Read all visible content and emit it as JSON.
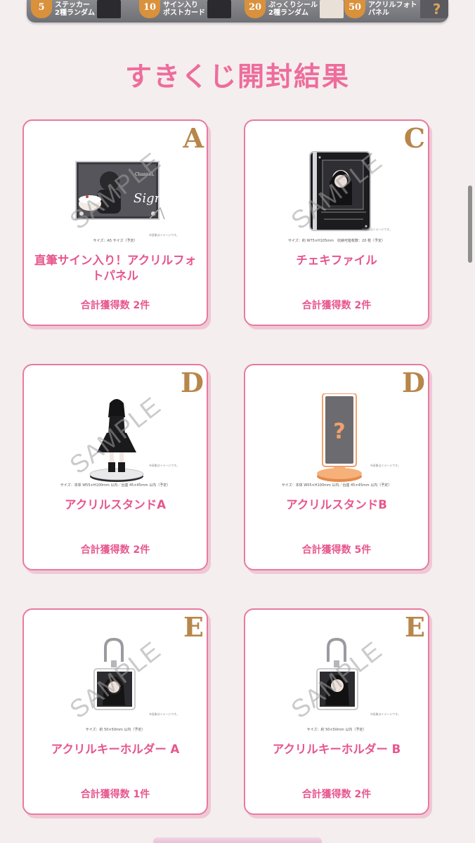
{
  "banner": {
    "bonuses": [
      {
        "badge": "5",
        "label_top": "ステッカー",
        "label_bottom": "2種ランダム"
      },
      {
        "badge": "10",
        "label_top": "サイン入り",
        "label_bottom": "ポストカード"
      },
      {
        "badge": "20",
        "label_top": "ぷっくりシール",
        "label_bottom": "2種ランダム"
      },
      {
        "badge": "50",
        "label_top": "アクリルフォト",
        "label_bottom": "パネル"
      }
    ],
    "mystery_mark": "?"
  },
  "title": "すきくじ開封結果",
  "cards": [
    {
      "rank": "A",
      "name": "直筆サイン入り！アクリルフォトパネル",
      "size": "サイズ：A5 サイズ（予定）",
      "count": "合計獲得数 2件",
      "watermark": "SAMPLE",
      "note": "※画像はイメージです。"
    },
    {
      "rank": "C",
      "name": "チェキファイル",
      "size": "サイズ：約 W75×H105mm　収納可能枚数：20 枚（予定）",
      "count": "合計獲得数 2件",
      "watermark": "SAMPLE",
      "note": "※画像はイメージです。"
    },
    {
      "rank": "D",
      "name": "アクリルスタンドA",
      "size": "サイズ：本体 W55×H100mm 以内／台座 45×45mm 以内（予定）",
      "count": "合計獲得数 2件",
      "watermark": "SAMPLE",
      "note": "※画像はイメージです。"
    },
    {
      "rank": "D",
      "name": "アクリルスタンドB",
      "size": "サイズ：本体 W55×H100mm 以内／台座 45×45mm 以内（予定）",
      "count": "合計獲得数 5件",
      "watermark": "",
      "note": "※画像はイメージです。"
    },
    {
      "rank": "E",
      "name": "アクリルキーホルダー A",
      "size": "サイズ：約 50×50mm 以内（予定）",
      "count": "合計獲得数 1件",
      "watermark": "SAMPLE",
      "note": "※画像はイメージです。"
    },
    {
      "rank": "E",
      "name": "アクリルキーホルダー B",
      "size": "サイズ：約 50×50mm 以内（予定）",
      "count": "合計獲得数 2件",
      "watermark": "SAMPLE",
      "note": "※画像はイメージです。"
    }
  ],
  "colors": {
    "accent": "#ee6c9c",
    "rank_gold": "#b8864a",
    "card_border": "#e87aa0"
  }
}
